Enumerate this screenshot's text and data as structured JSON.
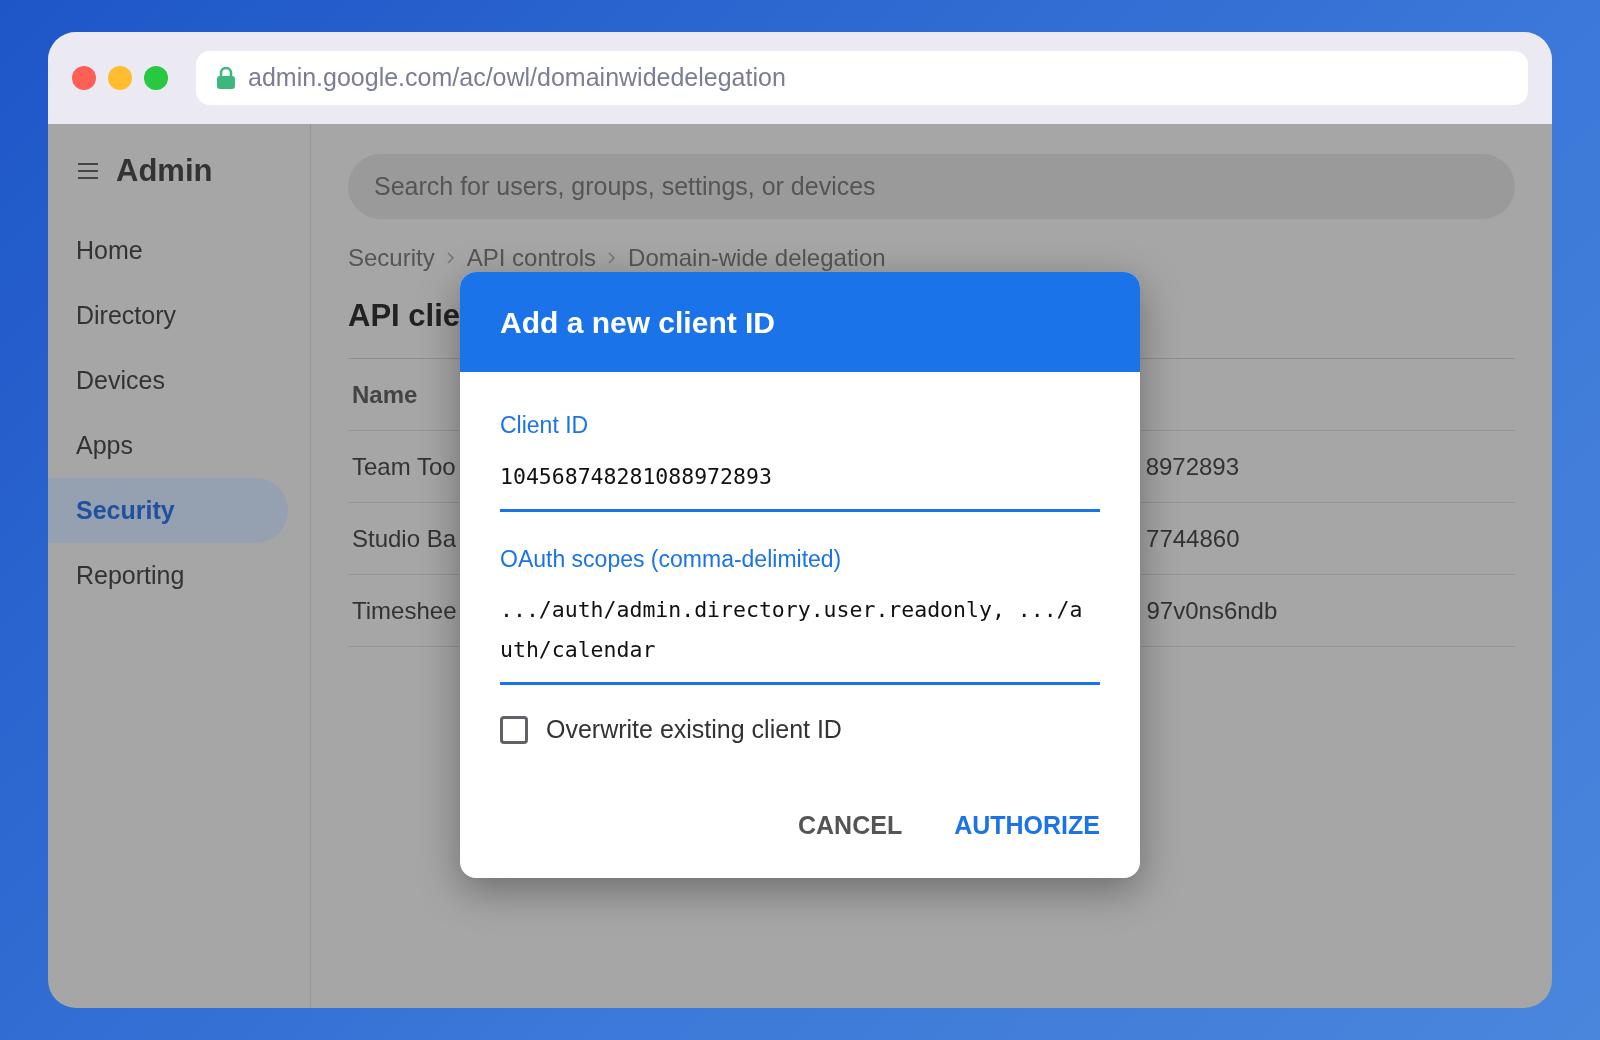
{
  "browser": {
    "url": "admin.google.com/ac/owl/domainwidedelegation",
    "secure": true
  },
  "sidebar": {
    "title": "Admin",
    "items": [
      {
        "label": "Home",
        "selected": false
      },
      {
        "label": "Directory",
        "selected": false
      },
      {
        "label": "Devices",
        "selected": false
      },
      {
        "label": "Apps",
        "selected": false
      },
      {
        "label": "Security",
        "selected": true
      },
      {
        "label": "Reporting",
        "selected": false
      }
    ]
  },
  "search": {
    "placeholder": "Search for users, groups, settings, or devices"
  },
  "breadcrumb": [
    "Security",
    "API controls",
    "Domain-wide delegation"
  ],
  "page_title": "API clie",
  "table": {
    "columns": [
      "Name"
    ],
    "rows": [
      {
        "name": "Team Too",
        "column_2": "8972893"
      },
      {
        "name": "Studio Ba",
        "column_2": "7744860"
      },
      {
        "name": "Timeshee",
        "column_2": "97v0ns6ndb"
      }
    ]
  },
  "dialog": {
    "title": "Add a new client ID",
    "fields": [
      {
        "label": "Client ID",
        "value": "104568748281088972893"
      },
      {
        "label": "OAuth scopes (comma-delimited)",
        "value": ".../auth/admin.directory.user.readonly, .../auth/calendar"
      }
    ],
    "checkbox": {
      "label": "Overwrite existing client ID",
      "checked": false
    },
    "buttons": [
      {
        "label": "CANCEL",
        "kind": "secondary"
      },
      {
        "label": "AUTHORIZE",
        "kind": "primary"
      }
    ]
  }
}
